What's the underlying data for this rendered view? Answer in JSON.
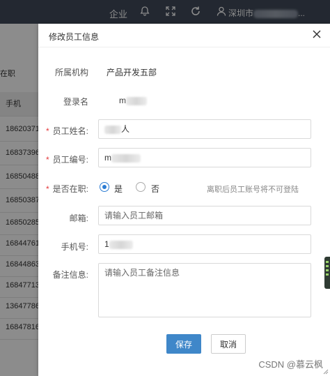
{
  "topbar": {
    "enterprise": "企业",
    "user_name": "深圳市",
    "user_suffix": "..."
  },
  "background": {
    "status_tab": "在职",
    "column_header": "手机",
    "phones": [
      "18620371",
      "16837396",
      "16850488",
      "16850387",
      "16850285",
      "16844761",
      "16844863",
      "16847713",
      "13647786",
      "16847816"
    ]
  },
  "dialog": {
    "title": "修改员工信息",
    "fields": {
      "org_label": "所属机构",
      "org_value": "产品开发五部",
      "login_label": "登录名",
      "login_value": "m",
      "name_label": "员工姓名:",
      "name_value": "人",
      "code_label": "员工编号:",
      "code_value": "m",
      "active_label": "是否在职:",
      "active_yes": "是",
      "active_no": "否",
      "active_hint": "离职后员工账号将不可登陆",
      "email_label": "邮箱:",
      "email_placeholder": "请输入员工邮箱",
      "phone_label": "手机号:",
      "phone_value": "1",
      "remark_label": "备注信息:",
      "remark_placeholder": "请输入员工备注信息"
    },
    "buttons": {
      "save": "保存",
      "cancel": "取消"
    },
    "required_mark": "*"
  },
  "watermark": "CSDN @慕云枫",
  "colors": {
    "topbar": "#404a59",
    "primary": "#3f87c9",
    "required": "#e4393c",
    "radio": "#2b7cd3"
  }
}
